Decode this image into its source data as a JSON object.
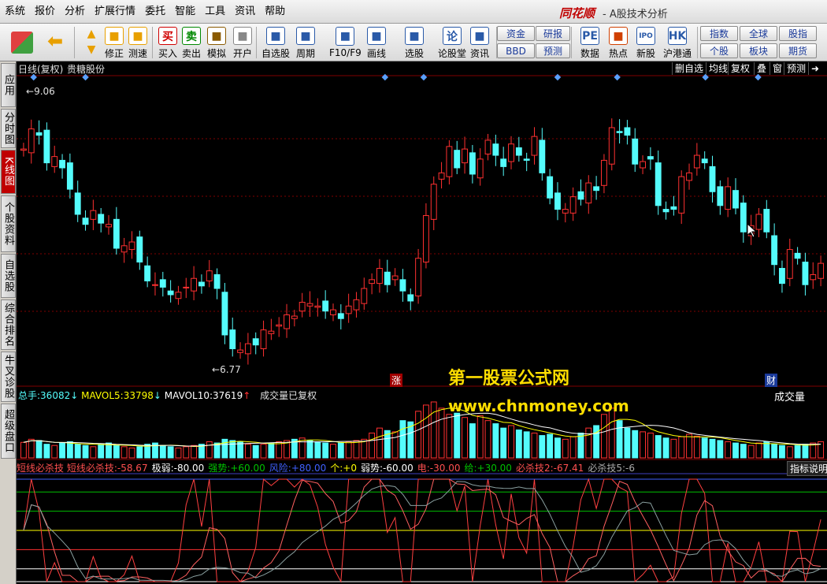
{
  "menu": [
    "系统",
    "报价",
    "分析",
    "扩展行情",
    "委托",
    "智能",
    "工具",
    "资讯",
    "帮助"
  ],
  "brand": {
    "logo": "同花顺",
    "subtitle": "- A股技术分析"
  },
  "toolbar": {
    "buttons": [
      {
        "label": "修正",
        "icon": "refresh-icon",
        "color": "#e8a000"
      },
      {
        "label": "测速",
        "icon": "clock-icon",
        "color": "#e8a000"
      },
      {
        "label": "买入",
        "icon": "buy-icon",
        "glyph": "买",
        "color": "#d00000"
      },
      {
        "label": "卖出",
        "icon": "sell-icon",
        "glyph": "卖",
        "color": "#008800"
      },
      {
        "label": "模拟",
        "icon": "hammer-icon",
        "color": "#8a5a00"
      },
      {
        "label": "开户",
        "icon": "lock-icon",
        "color": "#888"
      },
      {
        "label": "自选股",
        "icon": "star-folder-icon",
        "color": "#2a5aa8"
      },
      {
        "label": "周期",
        "icon": "period-icon",
        "color": "#2a5aa8"
      },
      {
        "label": "F10/F9",
        "icon": "f10-icon",
        "color": "#2a5aa8"
      },
      {
        "label": "画线",
        "icon": "pen-icon",
        "color": "#2a5aa8"
      },
      {
        "label": "选股",
        "icon": "select-stock-icon",
        "color": "#2a5aa8"
      },
      {
        "label": "论股堂",
        "icon": "forum-icon",
        "glyph": "论",
        "color": "#2a5aa8"
      },
      {
        "label": "资讯",
        "icon": "news-icon",
        "color": "#2a5aa8"
      },
      {
        "label": "数据",
        "icon": "pe-icon",
        "glyph": "PE",
        "color": "#2a5aa8"
      },
      {
        "label": "热点",
        "icon": "hot-icon",
        "color": "#d04000"
      },
      {
        "label": "新股",
        "icon": "ipo-icon",
        "glyph": "IPO",
        "color": "#2a5aa8"
      },
      {
        "label": "沪港通",
        "icon": "hk-connect-icon",
        "glyph": "HK",
        "color": "#2a5aa8"
      }
    ],
    "boxes": [
      {
        "label": "资金"
      },
      {
        "label": "BBD"
      },
      {
        "label": "研报"
      },
      {
        "label": "预测"
      },
      {
        "label": "指数"
      },
      {
        "label": "全球"
      },
      {
        "label": "股指"
      },
      {
        "label": "个股"
      },
      {
        "label": "板块"
      },
      {
        "label": "期货"
      }
    ]
  },
  "side_tabs": [
    "应用",
    "分时图",
    "K线图",
    "个股资料",
    "自选股",
    "综合排名",
    "牛叉诊股",
    "超级盘口"
  ],
  "active_side_tab": "K线图",
  "main": {
    "period": "日线(复权)",
    "stock_name": "贵糖股份",
    "right_tabs": [
      "删自选",
      "均线",
      "复权",
      "叠",
      "窗",
      "预测"
    ],
    "high_label": "9.06",
    "low_label": "6.77",
    "markers": [
      "涨",
      "财"
    ]
  },
  "volume": {
    "total_label": "总手:",
    "total_value": "36082",
    "ma5_label": "MAVOL5:",
    "ma5_value": "33798",
    "ma10_label": "MAVOL10:",
    "ma10_value": "37619",
    "note": "成交量已复权",
    "title": "成交量"
  },
  "indicator": {
    "name": "短线必杀技",
    "items": [
      {
        "label": "短线必杀技:",
        "value": "-58.67",
        "color": "#ff5050"
      },
      {
        "label": "极弱:",
        "value": "-80.00",
        "color": "#ffffff"
      },
      {
        "label": "强势:",
        "value": "+60.00",
        "color": "#00c000"
      },
      {
        "label": "风险:",
        "value": "+80.00",
        "color": "#4060ff"
      },
      {
        "label": "个:",
        "value": "+0",
        "color": "#ffff00"
      },
      {
        "label": "弱势:",
        "value": "-60.00",
        "color": "#ffffff"
      },
      {
        "label": "电:",
        "value": "-30.00",
        "color": "#ff5050"
      },
      {
        "label": "给:",
        "value": "+30.00",
        "color": "#00c000"
      },
      {
        "label": "必杀技2:",
        "value": "-67.41",
        "color": "#ff5050"
      },
      {
        "label": "必杀技5:",
        "value": "-6",
        "color": "#aaaaaa"
      }
    ],
    "help": "指标说明"
  },
  "watermark": {
    "line1": "第一股票公式网",
    "line2": "www.chnmoney.com"
  },
  "colors": {
    "up": "#ff3030",
    "down": "#54fcfc",
    "grid": "#800000",
    "ma": "#ffffff"
  },
  "chart_data": [
    {
      "type": "candlestick",
      "ylim": [
        6.77,
        9.06
      ],
      "close": [
        8.52,
        8.68,
        8.63,
        8.41,
        8.46,
        8.37,
        8.2,
        8.0,
        7.92,
        8.03,
        7.93,
        7.92,
        7.73,
        7.75,
        7.78,
        7.62,
        7.47,
        7.44,
        7.42,
        7.36,
        7.38,
        7.42,
        7.49,
        7.43,
        7.55,
        7.41,
        7.04,
        6.93,
        6.92,
        6.97,
        6.96,
        7.08,
        7.07,
        7.12,
        7.2,
        7.19,
        7.3,
        7.29,
        7.27,
        7.23,
        7.24,
        7.17,
        7.27,
        7.32,
        7.41,
        7.48,
        7.57,
        7.44,
        7.51,
        7.39,
        7.31,
        7.65,
        7.99,
        8.24,
        8.33,
        8.54,
        8.37,
        8.52,
        8.32,
        8.44,
        8.59,
        8.47,
        8.38,
        8.56,
        8.47,
        8.43,
        8.62,
        8.33,
        8.13,
        8.04,
        8.04,
        8.14,
        8.12,
        8.25,
        8.19,
        8.43,
        8.69,
        8.65,
        8.63,
        8.4,
        8.42,
        8.44,
        8.07,
        8.02,
        8.04,
        8.3,
        8.33,
        8.47,
        8.41,
        8.18,
        8.07,
        8.22,
        8.05,
        7.86,
        7.91,
        8.0,
        7.86,
        7.6,
        7.45,
        7.72,
        7.65,
        7.44,
        7.52,
        7.61
      ],
      "volume": [
        25,
        30,
        28,
        22,
        20,
        24,
        26,
        22,
        20,
        18,
        22,
        24,
        20,
        18,
        16,
        18,
        22,
        24,
        20,
        18,
        16,
        18,
        20,
        22,
        26,
        24,
        30,
        28,
        26,
        22,
        20,
        22,
        24,
        26,
        28,
        30,
        32,
        28,
        26,
        24,
        22,
        24,
        26,
        28,
        30,
        40,
        48,
        44,
        42,
        60,
        58,
        75,
        85,
        90,
        80,
        70,
        72,
        65,
        55,
        68,
        60,
        55,
        48,
        52,
        45,
        42,
        40,
        36,
        38,
        32,
        30,
        34,
        40,
        48,
        52,
        70,
        80,
        60,
        48,
        44,
        42,
        40,
        36,
        32,
        30,
        34,
        38,
        35,
        32,
        30,
        28,
        26,
        24,
        22,
        20,
        24,
        26,
        22,
        20,
        18,
        20,
        22,
        24,
        26
      ]
    }
  ]
}
